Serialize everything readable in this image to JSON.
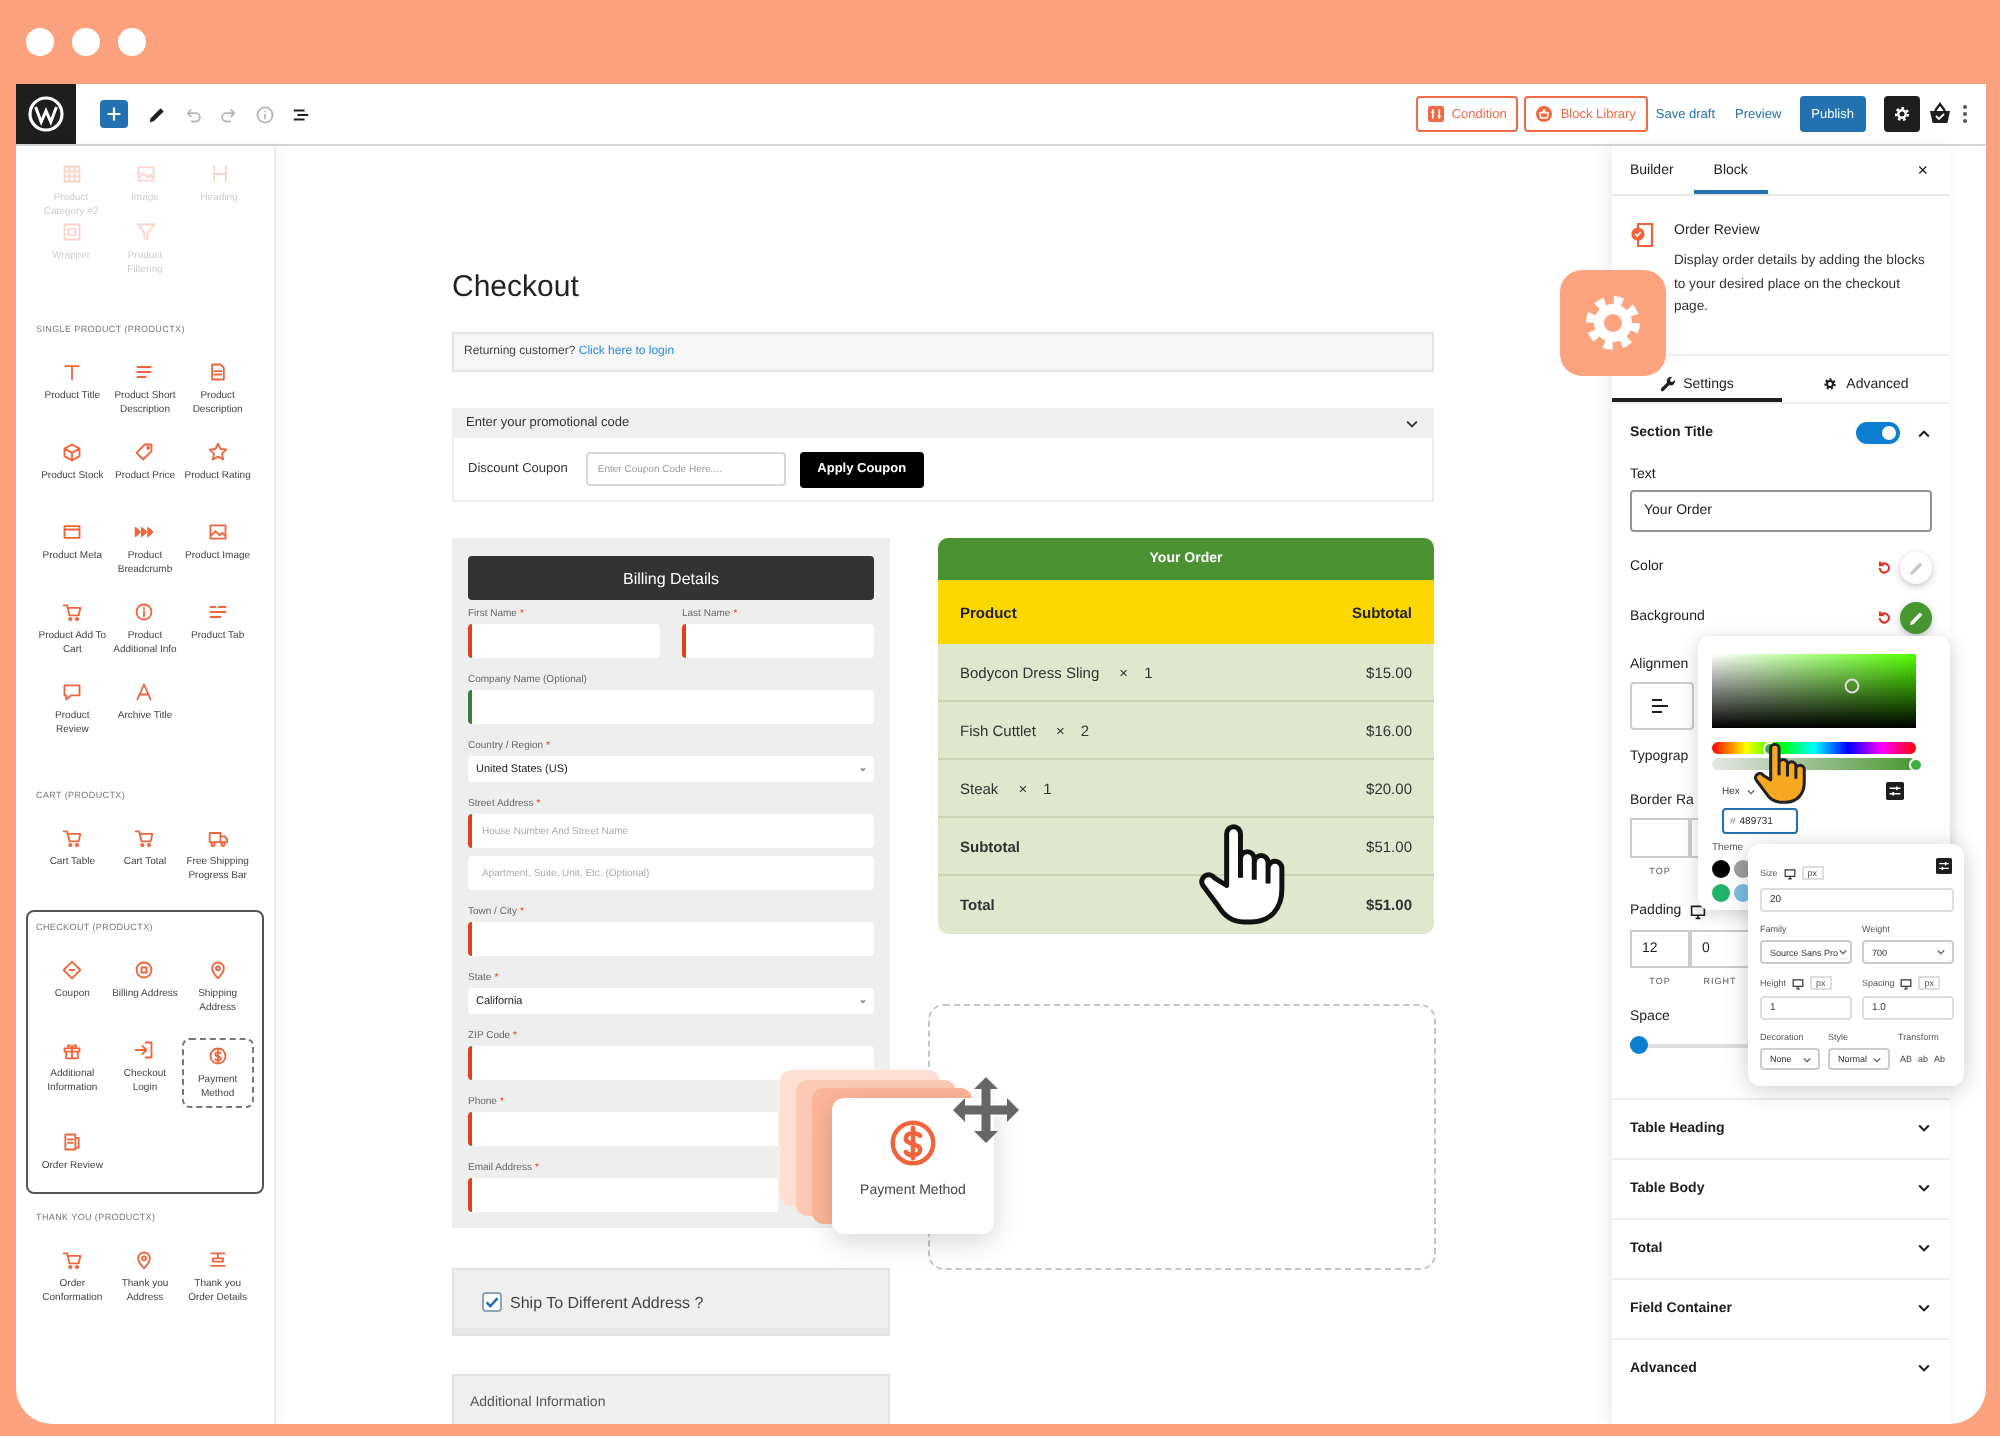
{
  "toolbar": {
    "buttons": [
      {
        "label": "Condition"
      },
      {
        "label": "Block Library"
      }
    ],
    "links": [
      "Save draft",
      "Preview"
    ],
    "publish": "Publish"
  },
  "sidebar": {
    "faded_items": [
      "Product Category #2",
      "Image",
      "Heading",
      "Wrapper",
      "Product Filtering"
    ],
    "sections": [
      {
        "title": "SINGLE PRODUCT (PRODUCTX)",
        "highlighted": false,
        "items": [
          {
            "label": "Product Title"
          },
          {
            "label": "Product Short Description"
          },
          {
            "label": "Product Description"
          },
          {
            "label": "Product Stock"
          },
          {
            "label": "Product Price"
          },
          {
            "label": "Product Rating"
          },
          {
            "label": "Product Meta"
          },
          {
            "label": "Product Breadcrumb"
          },
          {
            "label": "Product Image"
          },
          {
            "label": "Product Add To Cart"
          },
          {
            "label": "Product Additional Info"
          },
          {
            "label": "Product Tab"
          },
          {
            "label": "Product Review"
          },
          {
            "label": "Archive Title"
          }
        ]
      },
      {
        "title": "CART (PRODUCTX)",
        "highlighted": false,
        "items": [
          {
            "label": "Cart Table"
          },
          {
            "label": "Cart Total"
          },
          {
            "label": "Free Shipping Progress Bar"
          }
        ]
      },
      {
        "title": "CHECKOUT (PRODUCTX)",
        "highlighted": true,
        "items": [
          {
            "label": "Coupon",
            "dragging": false
          },
          {
            "label": "Billing Address",
            "dragging": false
          },
          {
            "label": "Shipping Address",
            "dragging": false
          },
          {
            "label": "Additional Information",
            "dragging": false
          },
          {
            "label": "Checkout Login",
            "dragging": false
          },
          {
            "label": "Payment Method",
            "dragging": true
          },
          {
            "label": "Order Review",
            "dragging": false
          }
        ]
      },
      {
        "title": "THANK YOU (PRODUCTX)",
        "highlighted": false,
        "items": [
          {
            "label": "Order Conformation"
          },
          {
            "label": "Thank you Address"
          },
          {
            "label": "Thank you Order Details"
          }
        ]
      }
    ]
  },
  "canvas": {
    "title": "Checkout",
    "returning": {
      "text": "Returning customer?",
      "link": "Click here to login"
    },
    "coupon": {
      "header": "Enter your promotional code",
      "expanded": true,
      "label": "Discount Coupon",
      "placeholder": "Enter Coupon Code Here....",
      "button": "Apply Coupon"
    },
    "billing": {
      "title": "Billing Details",
      "rows": [
        [
          {
            "label": "First Name",
            "mark": "*",
            "kind": "input",
            "color": "#e2401c"
          },
          {
            "label": "Last Name",
            "mark": "*",
            "kind": "input",
            "color": "#e2401c"
          }
        ],
        [
          {
            "label": "Company Name (Optional)",
            "kind": "input",
            "color": "#3a7d44"
          }
        ],
        [
          {
            "label": "Country / Region",
            "mark": "*",
            "kind": "select",
            "value": "United States (US)"
          }
        ],
        [
          {
            "label": "Street Address",
            "mark": "*",
            "kind": "input",
            "color": "#e2401c",
            "placeholder": "House Number And Street Name"
          }
        ],
        [
          {
            "kind": "input",
            "placeholder": "Apartment, Suite, Unit, Etc. (Optional)"
          }
        ],
        [
          {
            "label": "Town / City",
            "mark": "*",
            "kind": "input",
            "color": "#e2401c"
          }
        ],
        [
          {
            "label": "State",
            "mark": "*",
            "kind": "select",
            "value": "California"
          }
        ],
        [
          {
            "label": "ZIP Code",
            "mark": "*",
            "kind": "input",
            "color": "#e2401c"
          }
        ],
        [
          {
            "label": "Phone",
            "mark": "*",
            "kind": "input",
            "color": "#e2401c"
          }
        ],
        [
          {
            "label": "Email Address",
            "mark": "*",
            "kind": "input",
            "color": "#e2401c"
          }
        ]
      ]
    },
    "shipping": {
      "label": "Ship To Different Address ?",
      "checked": true
    },
    "additional": {
      "title": "Additional Information"
    },
    "order": {
      "title": "Your Order",
      "columns": [
        "Product",
        "Subtotal"
      ],
      "items": [
        {
          "name": "Bodycon Dress Sling",
          "qty": "× 1",
          "price": "$15.00"
        },
        {
          "name": "Fish Cuttlet",
          "qty": "× 2",
          "price": "$16.00"
        },
        {
          "name": "Steak",
          "qty": "× 1",
          "price": "$20.00"
        }
      ],
      "totals": [
        {
          "label": "Subtotal",
          "value": "$51.00",
          "kind": "subtotal"
        },
        {
          "label": "Total",
          "value": "$51.00",
          "kind": "total"
        }
      ]
    },
    "dragged_block": {
      "label": "Payment Method"
    }
  },
  "panel": {
    "tabs": [
      {
        "label": "Builder",
        "selected": false
      },
      {
        "label": "Block",
        "selected": true
      }
    ],
    "close": "×",
    "block": {
      "title": "Order Review",
      "description": "Display order details by adding the blocks to your desired place on the checkout page."
    },
    "subtabs": [
      {
        "label": "Settings",
        "selected": true
      },
      {
        "label": "Advanced",
        "selected": false
      }
    ],
    "section_title": {
      "label": "Section Title",
      "on": true,
      "expanded": true
    },
    "text_field": {
      "label": "Text",
      "value": "Your Order"
    },
    "colors": [
      {
        "label": "Color",
        "color": "#ffffff"
      },
      {
        "label": "Background",
        "color": "#489731"
      }
    ],
    "alignment": {
      "label": "Alignmen"
    },
    "typography": {
      "label": "Typograp"
    },
    "border_radius": {
      "label": "Border Ra",
      "sides": [
        "TOP"
      ]
    },
    "padding": {
      "label": "Padding",
      "sides": [
        {
          "value": "12",
          "label": "TOP"
        },
        {
          "value": "0",
          "label": "RIGHT"
        }
      ]
    },
    "space": {
      "label": "Space",
      "level": 0
    },
    "sections": [
      {
        "label": "Table Heading",
        "expanded": false
      },
      {
        "label": "Table Body",
        "expanded": false
      },
      {
        "label": "Total",
        "expanded": false
      },
      {
        "label": "Field Container",
        "expanded": false
      },
      {
        "label": "Advanced",
        "expanded": false
      }
    ],
    "color_picker": {
      "hue": {
        "level": 0.28
      },
      "alpha": {
        "level": 1
      },
      "format": "Hex",
      "prefix": "#",
      "hex": "489731",
      "theme_label": "Theme",
      "swatches": [
        {
          "color": "#000000"
        },
        {
          "color": "#9e9e9e"
        },
        {
          "color": "#1fb46a"
        },
        {
          "color": "#7cbde6"
        }
      ]
    },
    "typography_popup": {
      "size": {
        "label": "Size",
        "unit": "px",
        "value": "20"
      },
      "family": {
        "label": "Family",
        "value": "Source Sans Pro"
      },
      "weight": {
        "label": "Weight",
        "value": "700"
      },
      "height": {
        "label": "Height",
        "unit": "px",
        "value": "1"
      },
      "spacing": {
        "label": "Spacing",
        "unit": "px",
        "value": "1.0"
      },
      "decoration": {
        "label": "Decoration",
        "value": "None"
      },
      "style": {
        "label": "Style",
        "value": "Normal"
      },
      "transform": {
        "label": "Transform",
        "options": [
          "AB",
          "ab",
          "Ab"
        ]
      }
    }
  }
}
